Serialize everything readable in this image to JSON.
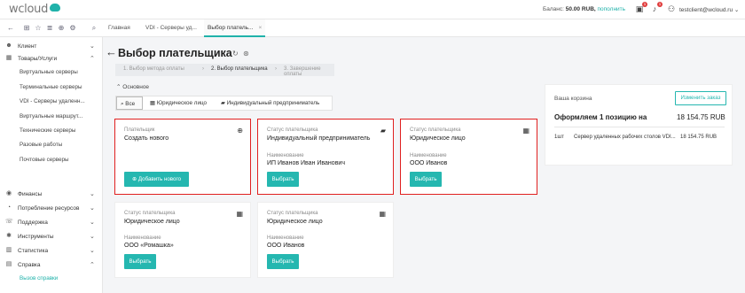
{
  "topbar": {
    "logo": "wcloud",
    "balance_label": "Баланс:",
    "balance_value": "50.00 RUB,",
    "balance_link": "пополнить",
    "cart_badge": "1",
    "notif_badge": "1",
    "user": "testclient@wcloud.ru"
  },
  "toolbar": {
    "icons": [
      "back-arrow-icon",
      "tree-icon",
      "star-icon",
      "list-icon",
      "add-icon",
      "settings-icon",
      "search-icon"
    ],
    "tabs": [
      {
        "label": "Главная"
      },
      {
        "label": "VDI - Серверы уд..."
      },
      {
        "label": "Выбор платель...",
        "close": "×"
      }
    ]
  },
  "sidebar": {
    "items": [
      {
        "icon": "users-icon",
        "label": "Клиент",
        "chev": "⌄"
      },
      {
        "icon": "box-icon",
        "label": "Товары/Услуги",
        "chev": "⌃"
      },
      {
        "icon": "finance-icon",
        "label": "Финансы",
        "chev": "⌄"
      },
      {
        "icon": "gauge-icon",
        "label": "Потребление ресурсов",
        "chev": "⌄"
      },
      {
        "icon": "support-icon",
        "label": "Поддержка",
        "chev": "⌄"
      },
      {
        "icon": "tools-icon",
        "label": "Инструменты",
        "chev": "⌄"
      },
      {
        "icon": "stats-icon",
        "label": "Статистика",
        "chev": "⌄"
      },
      {
        "icon": "help-icon",
        "label": "Справка",
        "chev": "⌃"
      }
    ],
    "goods_sub": [
      "Виртуальные серверы",
      "Терминальные серверы",
      "VDI - Серверы удаленн...",
      "Виртуальные маршрут...",
      "Технические серверы",
      "Разовые работы",
      "Почтовые серверы"
    ],
    "help_sub": [
      "Вызов справки"
    ]
  },
  "main": {
    "back": "←",
    "title": "Выбор плательщика",
    "steps": [
      "1. Выбор метода оплаты",
      "›",
      "2. Выбор плательщика",
      "›",
      "3. Завершение оплаты"
    ],
    "section": "Основное",
    "filters": [
      "Все",
      "Юридическое лицо",
      "Индивидуальный предприниматель"
    ]
  },
  "cards": [
    {
      "label1": "Плательщик",
      "value1": "Создать нового",
      "label2": "",
      "value2": "",
      "button": "Добавить нового",
      "icon": "plus-circle-icon"
    },
    {
      "label1": "Статус плательщика",
      "value1": "Индивидуальный предприниматель",
      "label2": "Наименование",
      "value2": "ИП Иванов Иван Иванович",
      "button": "Выбрать",
      "icon": "briefcase-icon"
    },
    {
      "label1": "Статус плательщика",
      "value1": "Юридическое лицо",
      "label2": "Наименование",
      "value2": "ООО Иванов",
      "button": "Выбрать",
      "icon": "building-icon"
    },
    {
      "label1": "Статус плательщика",
      "value1": "Юридическое лицо",
      "label2": "Наименование",
      "value2": "ООО «Ромашка»",
      "button": "Выбрать",
      "icon": "building-icon"
    },
    {
      "label1": "Статус плательщика",
      "value1": "Юридическое лицо",
      "label2": "Наименование",
      "value2": "ООО Иванов",
      "button": "Выбрать",
      "icon": "building-icon"
    }
  ],
  "cart": {
    "heading": "Ваша корзина",
    "change_button": "Изменить заказ",
    "summary_left": "Оформляем 1 позицию на",
    "summary_right": "18 154.75 RUB",
    "qty": "1шт",
    "name": "Сервер удаленных рабочих столов VDI...",
    "price": "18 154.75 RUB"
  },
  "colors": {
    "accent": "#25b7b0",
    "highlight": "#e02020"
  }
}
